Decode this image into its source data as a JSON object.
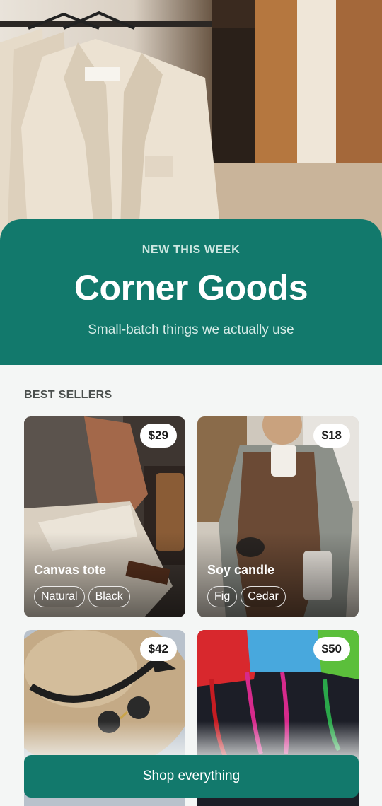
{
  "hero": {
    "image": "clothing-rack-photo"
  },
  "banner": {
    "eyebrow": "NEW THIS WEEK",
    "title": "Corner Goods",
    "subtitle": "Small-batch things we actually use"
  },
  "best_sellers": {
    "label": "BEST SELLERS",
    "products": [
      {
        "name": "Canvas tote",
        "price": "$29",
        "tags": [
          "Natural",
          "Black"
        ]
      },
      {
        "name": "Soy candle",
        "price": "$18",
        "tags": [
          "Fig",
          "Cedar"
        ]
      },
      {
        "name": "",
        "price": "$42",
        "tags": []
      },
      {
        "name": "",
        "price": "$50",
        "tags": []
      }
    ]
  },
  "cta": {
    "label": "Shop everything"
  },
  "colors": {
    "accent": "#12796c",
    "background": "#f4f6f5"
  }
}
